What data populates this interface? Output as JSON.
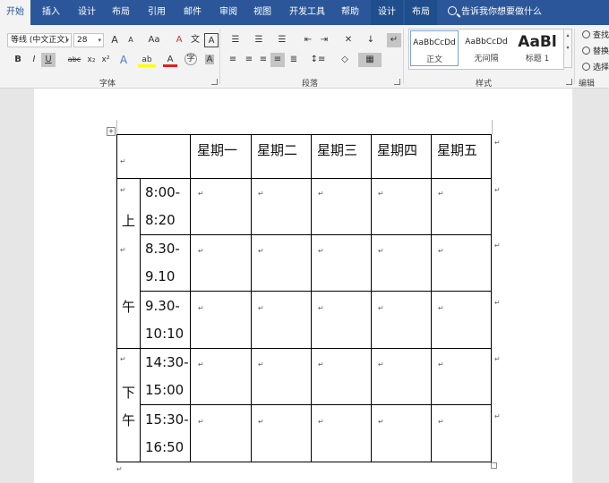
{
  "tabs": [
    "开始",
    "插入",
    "设计",
    "布局",
    "引用",
    "邮件",
    "审阅",
    "视图",
    "开发工具",
    "帮助",
    "设计",
    "布局"
  ],
  "tell_me": "告诉我你想要做什么",
  "font": {
    "name": "等线 (中文正文)",
    "size": "28",
    "group_label": "字体"
  },
  "paragraph": {
    "group_label": "段落"
  },
  "styles": {
    "group_label": "样式",
    "tiles": [
      {
        "sample": "AaBbCcDd",
        "name": "正文"
      },
      {
        "sample": "AaBbCcDd",
        "name": "无间隔"
      },
      {
        "sample": "AaBl",
        "name": "标题 1"
      }
    ]
  },
  "editing": {
    "group_label": "编辑",
    "items": [
      "查找",
      "替换",
      "选择"
    ]
  },
  "toolbar_glyphs": {
    "bold": "B",
    "italic": "I",
    "underline": "U",
    "strike": "abc",
    "subscript": "x₂",
    "superscript": "x²",
    "grow": "A",
    "shrink": "A",
    "case": "Aa",
    "clear": "A",
    "char_border": "A",
    "text_effect": "A",
    "highlight": "ab",
    "font_color": "A",
    "enclose": "字"
  },
  "paragraph_mark": "↵",
  "table": {
    "headers": [
      "星期一",
      "星期二",
      "星期三",
      "星期四",
      "星期五"
    ],
    "period_am": [
      "上",
      "午"
    ],
    "period_pm": [
      "下",
      "午"
    ],
    "times": [
      [
        "8:00-",
        "8:20"
      ],
      [
        "8.30-",
        "9.10"
      ],
      [
        "9.30-",
        "10:10"
      ],
      [
        "14:30-",
        "15:00"
      ],
      [
        "15:30-",
        "16:50"
      ]
    ]
  }
}
